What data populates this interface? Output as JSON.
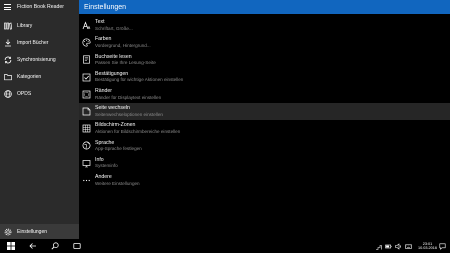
{
  "app": {
    "title": "Fiction Book Reader"
  },
  "sidebar": {
    "items": [
      {
        "label": "Library",
        "icon": "library-icon"
      },
      {
        "label": "Import Bücher",
        "icon": "download-icon"
      },
      {
        "label": "Synchronisierung",
        "icon": "sync-icon"
      },
      {
        "label": "Kategorien",
        "icon": "folder-icon"
      },
      {
        "label": "OPDS",
        "icon": "globe-icon"
      }
    ],
    "bottom": {
      "label": "Einstellungen",
      "icon": "gear-icon"
    }
  },
  "main": {
    "title": "Einstellungen",
    "header_color": "#1166bf",
    "settings": [
      {
        "title": "Text",
        "subtitle": "Schriftart, Größe...",
        "icon": "text-icon"
      },
      {
        "title": "Farben",
        "subtitle": "Vordergrund, Hintergrund...",
        "icon": "palette-icon"
      },
      {
        "title": "Buchseite lesen",
        "subtitle": "Passen Sie Ihre Lesung-Seite",
        "icon": "book-page-icon"
      },
      {
        "title": "Bestätigungen",
        "subtitle": "Bestätigung für wichtige Aktionen einstellen",
        "icon": "checkbox-icon"
      },
      {
        "title": "Ränder",
        "subtitle": "Ränder für Displaytext einstellen",
        "icon": "margins-icon"
      },
      {
        "title": "Seite wechseln",
        "subtitle": "Seitenwechseloptionen einstellen",
        "icon": "page-turn-icon",
        "selected": true
      },
      {
        "title": "Bildschirm-Zonen",
        "subtitle": "Aktionen für Bildschirmbereiche einstellen",
        "icon": "grid-icon"
      },
      {
        "title": "Sprache",
        "subtitle": "App-Sprache festlegen",
        "icon": "language-icon"
      },
      {
        "title": "Info",
        "subtitle": "Systeminfo",
        "icon": "info-icon"
      },
      {
        "title": "Andere",
        "subtitle": "Weitere Einstellungen",
        "icon": "more-icon"
      }
    ]
  },
  "taskbar": {
    "time": "23:01",
    "date": "10.03.2016"
  }
}
